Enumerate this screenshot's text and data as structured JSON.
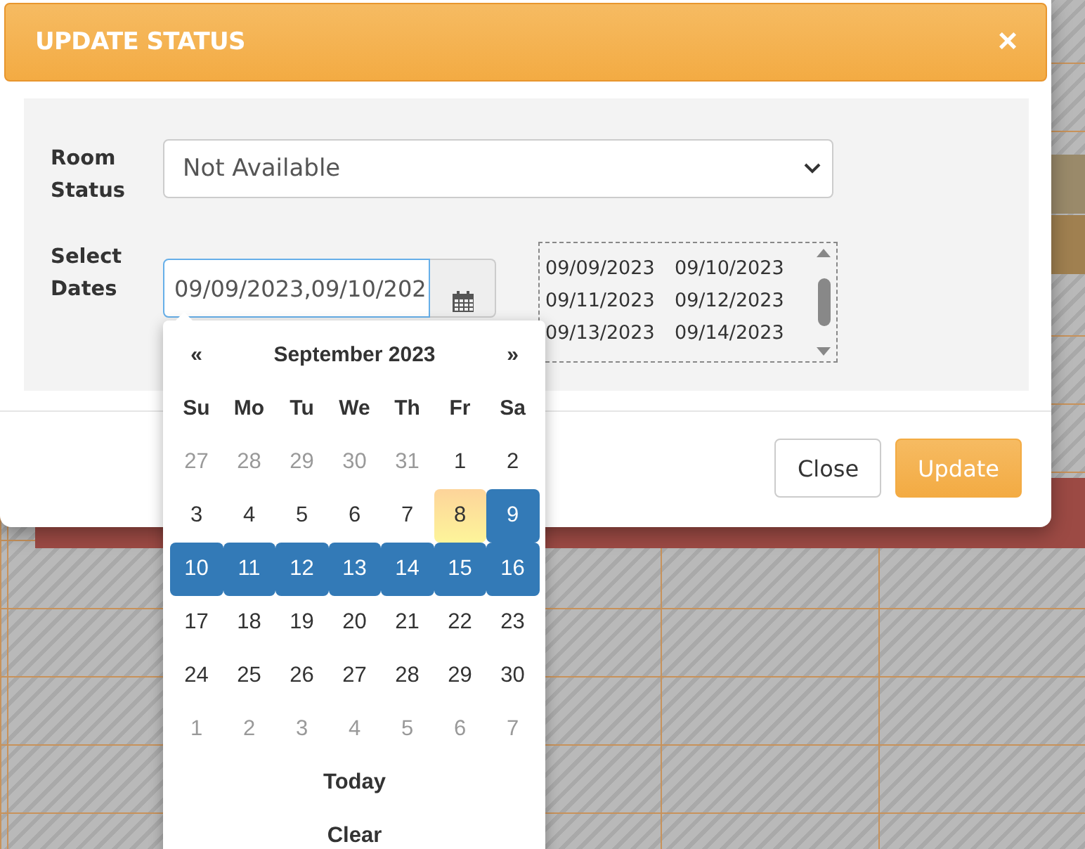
{
  "dialog": {
    "title": "UPDATE STATUS",
    "close_glyph": "×"
  },
  "room_status": {
    "label": "Room Status",
    "value": "Not Available"
  },
  "select_dates": {
    "label": "Select Dates",
    "value": "09/09/2023,09/10/202"
  },
  "selected_dates": [
    "09/09/2023",
    "09/10/2023",
    "09/11/2023",
    "09/12/2023",
    "09/13/2023",
    "09/14/2023"
  ],
  "calendar": {
    "prev": "«",
    "next": "»",
    "month": "September 2023",
    "weekdays": [
      "Su",
      "Mo",
      "Tu",
      "We",
      "Th",
      "Fr",
      "Sa"
    ],
    "days": [
      {
        "label": "27",
        "muted": true,
        "selected": false,
        "today": false
      },
      {
        "label": "28",
        "muted": true,
        "selected": false,
        "today": false
      },
      {
        "label": "29",
        "muted": true,
        "selected": false,
        "today": false
      },
      {
        "label": "30",
        "muted": true,
        "selected": false,
        "today": false
      },
      {
        "label": "31",
        "muted": true,
        "selected": false,
        "today": false
      },
      {
        "label": "1",
        "muted": false,
        "selected": false,
        "today": false
      },
      {
        "label": "2",
        "muted": false,
        "selected": false,
        "today": false
      },
      {
        "label": "3",
        "muted": false,
        "selected": false,
        "today": false
      },
      {
        "label": "4",
        "muted": false,
        "selected": false,
        "today": false
      },
      {
        "label": "5",
        "muted": false,
        "selected": false,
        "today": false
      },
      {
        "label": "6",
        "muted": false,
        "selected": false,
        "today": false
      },
      {
        "label": "7",
        "muted": false,
        "selected": false,
        "today": false
      },
      {
        "label": "8",
        "muted": false,
        "selected": false,
        "today": true
      },
      {
        "label": "9",
        "muted": false,
        "selected": true,
        "today": false
      },
      {
        "label": "10",
        "muted": false,
        "selected": true,
        "today": false
      },
      {
        "label": "11",
        "muted": false,
        "selected": true,
        "today": false
      },
      {
        "label": "12",
        "muted": false,
        "selected": true,
        "today": false
      },
      {
        "label": "13",
        "muted": false,
        "selected": true,
        "today": false
      },
      {
        "label": "14",
        "muted": false,
        "selected": true,
        "today": false
      },
      {
        "label": "15",
        "muted": false,
        "selected": true,
        "today": false
      },
      {
        "label": "16",
        "muted": false,
        "selected": true,
        "today": false
      },
      {
        "label": "17",
        "muted": false,
        "selected": false,
        "today": false
      },
      {
        "label": "18",
        "muted": false,
        "selected": false,
        "today": false
      },
      {
        "label": "19",
        "muted": false,
        "selected": false,
        "today": false
      },
      {
        "label": "20",
        "muted": false,
        "selected": false,
        "today": false
      },
      {
        "label": "21",
        "muted": false,
        "selected": false,
        "today": false
      },
      {
        "label": "22",
        "muted": false,
        "selected": false,
        "today": false
      },
      {
        "label": "23",
        "muted": false,
        "selected": false,
        "today": false
      },
      {
        "label": "24",
        "muted": false,
        "selected": false,
        "today": false
      },
      {
        "label": "25",
        "muted": false,
        "selected": false,
        "today": false
      },
      {
        "label": "26",
        "muted": false,
        "selected": false,
        "today": false
      },
      {
        "label": "27",
        "muted": false,
        "selected": false,
        "today": false
      },
      {
        "label": "28",
        "muted": false,
        "selected": false,
        "today": false
      },
      {
        "label": "29",
        "muted": false,
        "selected": false,
        "today": false
      },
      {
        "label": "30",
        "muted": false,
        "selected": false,
        "today": false
      },
      {
        "label": "1",
        "muted": true,
        "selected": false,
        "today": false
      },
      {
        "label": "2",
        "muted": true,
        "selected": false,
        "today": false
      },
      {
        "label": "3",
        "muted": true,
        "selected": false,
        "today": false
      },
      {
        "label": "4",
        "muted": true,
        "selected": false,
        "today": false
      },
      {
        "label": "5",
        "muted": true,
        "selected": false,
        "today": false
      },
      {
        "label": "6",
        "muted": true,
        "selected": false,
        "today": false
      },
      {
        "label": "7",
        "muted": true,
        "selected": false,
        "today": false
      }
    ],
    "today_button": "Today",
    "clear_button": "Clear"
  },
  "buttons": [
    {
      "label": "Close",
      "kind": "default"
    },
    {
      "label": "Update",
      "kind": "primary"
    }
  ]
}
